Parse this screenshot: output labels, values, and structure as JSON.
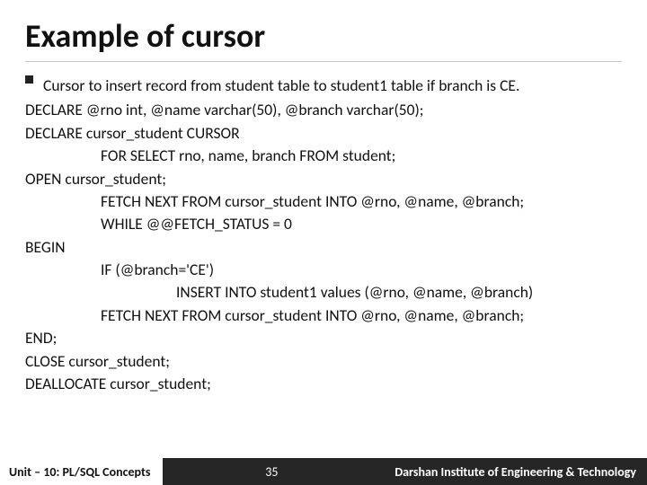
{
  "title": "Example of cursor",
  "bullet": "Cursor to insert record from student table to student1 table if branch is CE.",
  "code": {
    "l0": "DECLARE @rno int, @name varchar(50), @branch varchar(50);",
    "l1": "DECLARE cursor_student CURSOR",
    "l2": "FOR SELECT rno, name, branch FROM student;",
    "l3": "OPEN cursor_student;",
    "l4": "FETCH NEXT FROM cursor_student INTO @rno, @name, @branch;",
    "l5": "WHILE @@FETCH_STATUS = 0",
    "l6": "BEGIN",
    "l7": "IF (@branch='CE')",
    "l8": "INSERT INTO student1 values (@rno, @name, @branch)",
    "l9": "FETCH NEXT FROM cursor_student INTO @rno, @name, @branch;",
    "l10": "END;",
    "l11": "CLOSE cursor_student;",
    "l12": "DEALLOCATE cursor_student;"
  },
  "footer": {
    "unit": "Unit – 10: PL/SQL Concepts",
    "page": "35",
    "institute": "Darshan Institute of Engineering & Technology"
  }
}
